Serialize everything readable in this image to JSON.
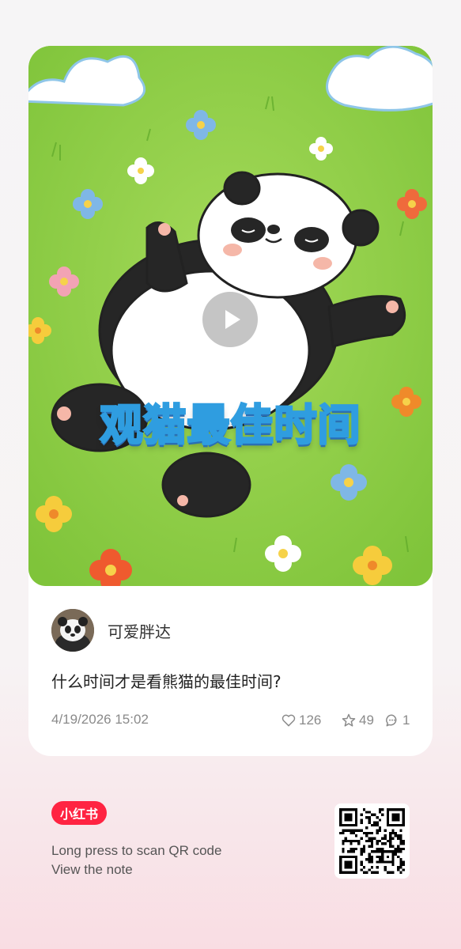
{
  "cover": {
    "title": "观猫最佳时间",
    "play_icon": "play-icon",
    "colors": {
      "grass": "#93d24b",
      "title_stroke": "#2f9de0"
    }
  },
  "author": {
    "name": "可爱胖达",
    "avatar_icon": "panda-avatar"
  },
  "note": {
    "title": "什么时间才是看熊猫的最佳时间?",
    "date": "4/19/2026 15:02",
    "likes": "126",
    "favorites": "49",
    "comments": "1"
  },
  "footer": {
    "logo_text": "小红书",
    "line1": "Long press to scan QR code",
    "line2": "View the note",
    "brand_color": "#ff2442"
  }
}
